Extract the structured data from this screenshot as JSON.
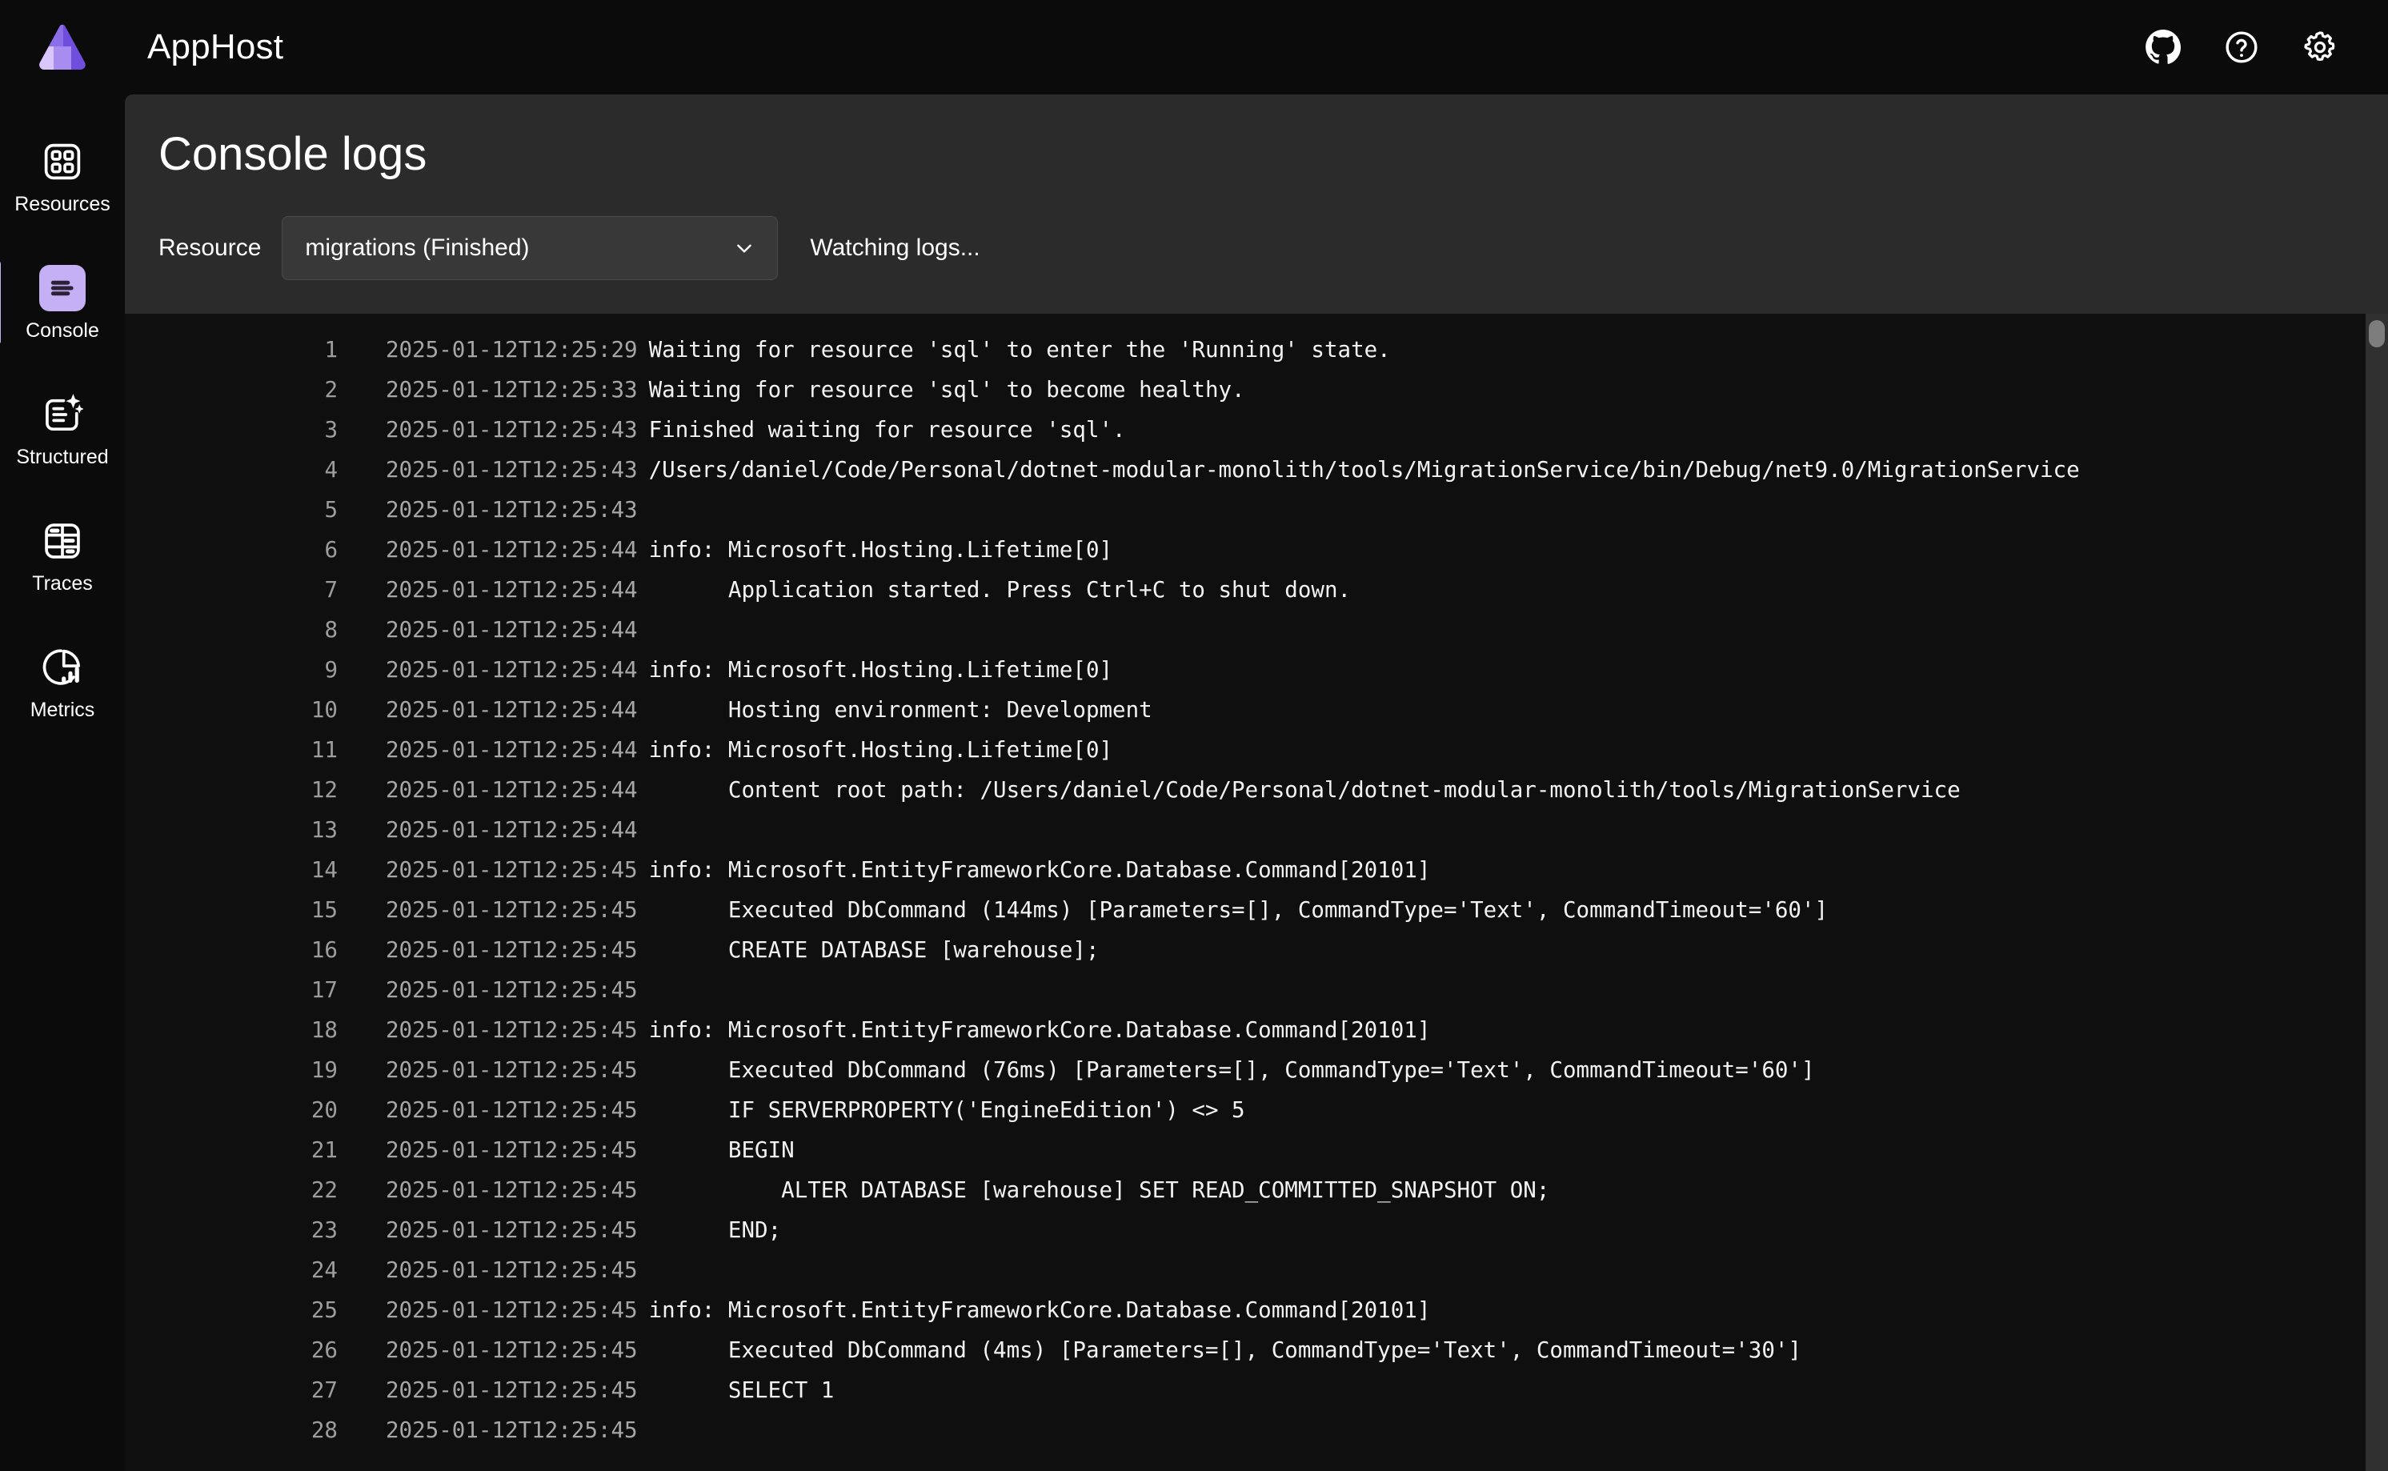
{
  "app": {
    "title": "AppHost",
    "logo_colors": [
      "#8b6ee8",
      "#a88cf0",
      "#d9c7fb"
    ]
  },
  "topbar": {
    "actions": [
      {
        "name": "github-icon",
        "label": "GitHub"
      },
      {
        "name": "help-icon",
        "label": "Help"
      },
      {
        "name": "settings-icon",
        "label": "Settings"
      }
    ]
  },
  "sidebar": {
    "accent": "#c5aff5",
    "items": [
      {
        "label": "Resources",
        "icon": "grid-icon",
        "active": false
      },
      {
        "label": "Console",
        "icon": "console-icon",
        "active": true
      },
      {
        "label": "Structured",
        "icon": "structured-logs-icon",
        "active": false
      },
      {
        "label": "Traces",
        "icon": "traces-icon",
        "active": false
      },
      {
        "label": "Metrics",
        "icon": "metrics-icon",
        "active": false
      }
    ]
  },
  "page": {
    "title": "Console logs"
  },
  "toolbar": {
    "resource_label": "Resource",
    "resource_value": "migrations (Finished)",
    "resource_options": [
      "migrations (Finished)"
    ],
    "status_text": "Watching logs..."
  },
  "logs": {
    "lines": [
      {
        "n": "1",
        "ts": "2025-01-12T12:25:29",
        "msg": "Waiting for resource 'sql' to enter the 'Running' state."
      },
      {
        "n": "2",
        "ts": "2025-01-12T12:25:33",
        "msg": "Waiting for resource 'sql' to become healthy."
      },
      {
        "n": "3",
        "ts": "2025-01-12T12:25:43",
        "msg": "Finished waiting for resource 'sql'."
      },
      {
        "n": "4",
        "ts": "2025-01-12T12:25:43",
        "msg": "/Users/daniel/Code/Personal/dotnet-modular-monolith/tools/MigrationService/bin/Debug/net9.0/MigrationService"
      },
      {
        "n": "5",
        "ts": "2025-01-12T12:25:43",
        "msg": ""
      },
      {
        "n": "6",
        "ts": "2025-01-12T12:25:44",
        "msg": "info: Microsoft.Hosting.Lifetime[0]"
      },
      {
        "n": "7",
        "ts": "2025-01-12T12:25:44",
        "msg": "      Application started. Press Ctrl+C to shut down."
      },
      {
        "n": "8",
        "ts": "2025-01-12T12:25:44",
        "msg": ""
      },
      {
        "n": "9",
        "ts": "2025-01-12T12:25:44",
        "msg": "info: Microsoft.Hosting.Lifetime[0]"
      },
      {
        "n": "10",
        "ts": "2025-01-12T12:25:44",
        "msg": "      Hosting environment: Development"
      },
      {
        "n": "11",
        "ts": "2025-01-12T12:25:44",
        "msg": "info: Microsoft.Hosting.Lifetime[0]"
      },
      {
        "n": "12",
        "ts": "2025-01-12T12:25:44",
        "msg": "      Content root path: /Users/daniel/Code/Personal/dotnet-modular-monolith/tools/MigrationService"
      },
      {
        "n": "13",
        "ts": "2025-01-12T12:25:44",
        "msg": ""
      },
      {
        "n": "14",
        "ts": "2025-01-12T12:25:45",
        "msg": "info: Microsoft.EntityFrameworkCore.Database.Command[20101]"
      },
      {
        "n": "15",
        "ts": "2025-01-12T12:25:45",
        "msg": "      Executed DbCommand (144ms) [Parameters=[], CommandType='Text', CommandTimeout='60']"
      },
      {
        "n": "16",
        "ts": "2025-01-12T12:25:45",
        "msg": "      CREATE DATABASE [warehouse];"
      },
      {
        "n": "17",
        "ts": "2025-01-12T12:25:45",
        "msg": ""
      },
      {
        "n": "18",
        "ts": "2025-01-12T12:25:45",
        "msg": "info: Microsoft.EntityFrameworkCore.Database.Command[20101]"
      },
      {
        "n": "19",
        "ts": "2025-01-12T12:25:45",
        "msg": "      Executed DbCommand (76ms) [Parameters=[], CommandType='Text', CommandTimeout='60']"
      },
      {
        "n": "20",
        "ts": "2025-01-12T12:25:45",
        "msg": "      IF SERVERPROPERTY('EngineEdition') <> 5"
      },
      {
        "n": "21",
        "ts": "2025-01-12T12:25:45",
        "msg": "      BEGIN"
      },
      {
        "n": "22",
        "ts": "2025-01-12T12:25:45",
        "msg": "          ALTER DATABASE [warehouse] SET READ_COMMITTED_SNAPSHOT ON;"
      },
      {
        "n": "23",
        "ts": "2025-01-12T12:25:45",
        "msg": "      END;"
      },
      {
        "n": "24",
        "ts": "2025-01-12T12:25:45",
        "msg": ""
      },
      {
        "n": "25",
        "ts": "2025-01-12T12:25:45",
        "msg": "info: Microsoft.EntityFrameworkCore.Database.Command[20101]"
      },
      {
        "n": "26",
        "ts": "2025-01-12T12:25:45",
        "msg": "      Executed DbCommand (4ms) [Parameters=[], CommandType='Text', CommandTimeout='30']"
      },
      {
        "n": "27",
        "ts": "2025-01-12T12:25:45",
        "msg": "      SELECT 1"
      },
      {
        "n": "28",
        "ts": "2025-01-12T12:25:45",
        "msg": ""
      }
    ]
  }
}
